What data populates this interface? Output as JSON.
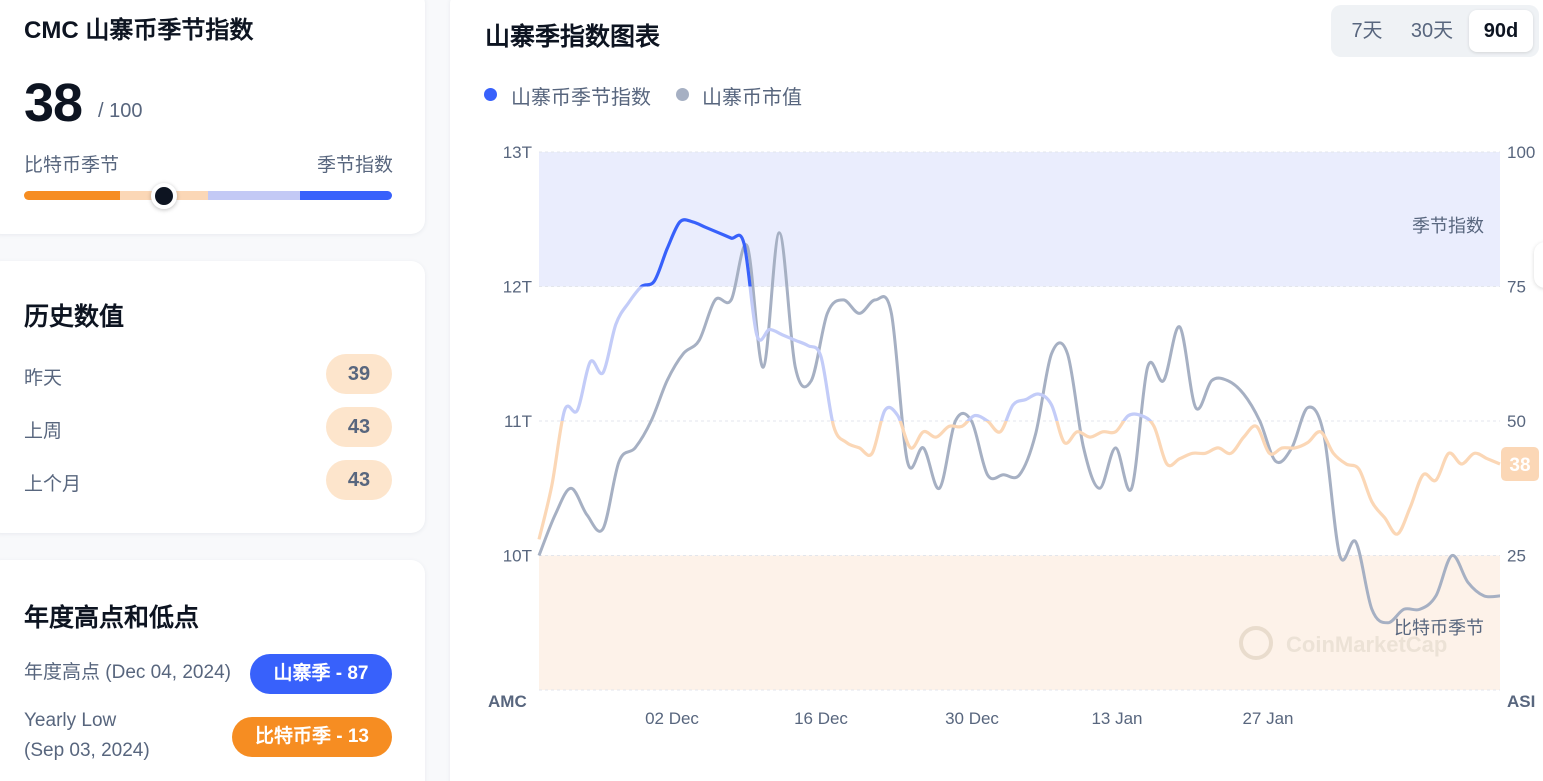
{
  "index_card": {
    "title": "CMC 山寨币季节指数",
    "value": "38",
    "max_label": "/ 100",
    "left_label": "比特币季节",
    "right_label": "季节指数",
    "gauge_position": 38,
    "gauge_colors": [
      "#f68d22",
      "#fbd7b6",
      "#c3c9f5",
      "#3861fb"
    ]
  },
  "history": {
    "title": "历史数值",
    "rows": [
      {
        "label": "昨天",
        "value": "39"
      },
      {
        "label": "上周",
        "value": "43"
      },
      {
        "label": "上个月",
        "value": "43"
      }
    ]
  },
  "yearly": {
    "title": "年度高点和低点",
    "high_label": "年度高点 (Dec 04, 2024)",
    "high_value": "山寨季 - 87",
    "low_label_line1": "Yearly Low",
    "low_label_line2": "(Sep 03, 2024)",
    "low_value": "比特币季 - 13",
    "high_color": "#3861fb",
    "low_color": "#f68d22"
  },
  "chart_panel": {
    "title": "山寨季指数图表",
    "ranges": [
      "7天",
      "30天",
      "90d"
    ],
    "active_range": "90d",
    "legend": [
      {
        "label": "山寨币季节指数",
        "color": "#3861fb"
      },
      {
        "label": "山寨币市值",
        "color": "#a6b0c3"
      }
    ]
  },
  "chart_data": {
    "type": "line",
    "x_labels": [
      "02 Dec",
      "16 Dec",
      "30 Dec",
      "13 Jan",
      "27 Jan"
    ],
    "left_axis_title": "AMC",
    "right_axis_title": "ASI",
    "left_ticks": [
      "13T",
      "12T",
      "11T",
      "10T"
    ],
    "right_ticks": [
      "100",
      "75",
      "50",
      "25"
    ],
    "left_range": [
      9,
      13
    ],
    "right_range": [
      0,
      100
    ],
    "bands": [
      {
        "label": "季节指数",
        "from": 75,
        "to": 100,
        "color": "#eaedfd"
      },
      {
        "label": "比特币季节",
        "from": 0,
        "to": 25,
        "color": "#fdf2e9"
      }
    ],
    "watermark": "CoinMarketCap",
    "current_value": "38",
    "series": [
      {
        "name": "山寨币季节指数",
        "axis": "right",
        "values": [
          28,
          38,
          52,
          52,
          61,
          59,
          68,
          72,
          75,
          76,
          82,
          87,
          87,
          86,
          85,
          84,
          83,
          66,
          67,
          66,
          65,
          64,
          62,
          49,
          46,
          45,
          44,
          52,
          51,
          45,
          48,
          47,
          49,
          49,
          51,
          50,
          48,
          53,
          54,
          55,
          53,
          46,
          48,
          47,
          48,
          48,
          51,
          51,
          49,
          42,
          43,
          44,
          44,
          45,
          44,
          47,
          49,
          44,
          45,
          45,
          46,
          48,
          44,
          42,
          41,
          35,
          32,
          29,
          34,
          40,
          39,
          44,
          42,
          44,
          43,
          42
        ]
      },
      {
        "name": "山寨币市值",
        "axis": "left",
        "values": [
          10.0,
          10.3,
          10.5,
          10.3,
          10.2,
          10.7,
          10.8,
          11.0,
          11.3,
          11.5,
          11.6,
          11.9,
          11.9,
          12.3,
          11.4,
          12.4,
          11.4,
          11.3,
          11.8,
          11.9,
          11.8,
          11.9,
          11.8,
          10.7,
          10.8,
          10.5,
          11.0,
          11.0,
          10.6,
          10.6,
          10.6,
          10.9,
          11.5,
          11.5,
          10.8,
          10.5,
          10.8,
          10.5,
          11.4,
          11.3,
          11.7,
          11.1,
          11.3,
          11.3,
          11.2,
          11.0,
          10.7,
          10.8,
          11.1,
          10.9,
          10.0,
          10.1,
          9.6,
          9.5,
          9.6,
          9.6,
          9.7,
          10.0,
          9.8,
          9.7,
          9.7
        ]
      }
    ]
  }
}
